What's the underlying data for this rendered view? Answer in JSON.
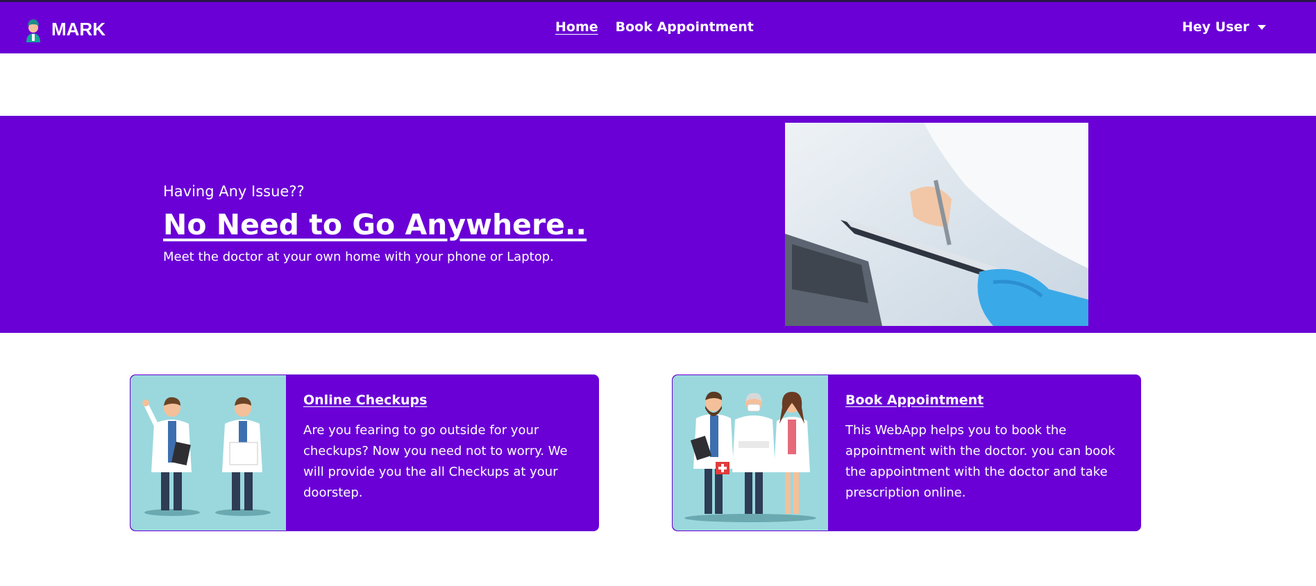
{
  "header": {
    "brand": "MARK",
    "nav": [
      {
        "label": "Home",
        "active": true
      },
      {
        "label": "Book Appointment",
        "active": false
      }
    ],
    "user_menu": "Hey User"
  },
  "hero": {
    "subtitle": "Having Any Issue??",
    "title": "No Need to Go Anywhere..",
    "description": "Meet the doctor at your own home with your phone or Laptop."
  },
  "cards": [
    {
      "title": "Online Checkups",
      "text": "Are you fearing to go outside for your checkups? Now you need not to worry. We will provide you the all Checkups at your doorstep."
    },
    {
      "title": "Book Appointment",
      "text": "This WebApp helps you to book the appointment with the doctor. you can book the appointment with the doctor and take prescription online."
    }
  ],
  "colors": {
    "brand_purple": "#6a00d6",
    "card_image_bg": "#9ad8de",
    "text": "#ffffff"
  },
  "icons": {
    "brand": "doctor-avatar-icon",
    "user_menu": "caret-down-icon"
  }
}
